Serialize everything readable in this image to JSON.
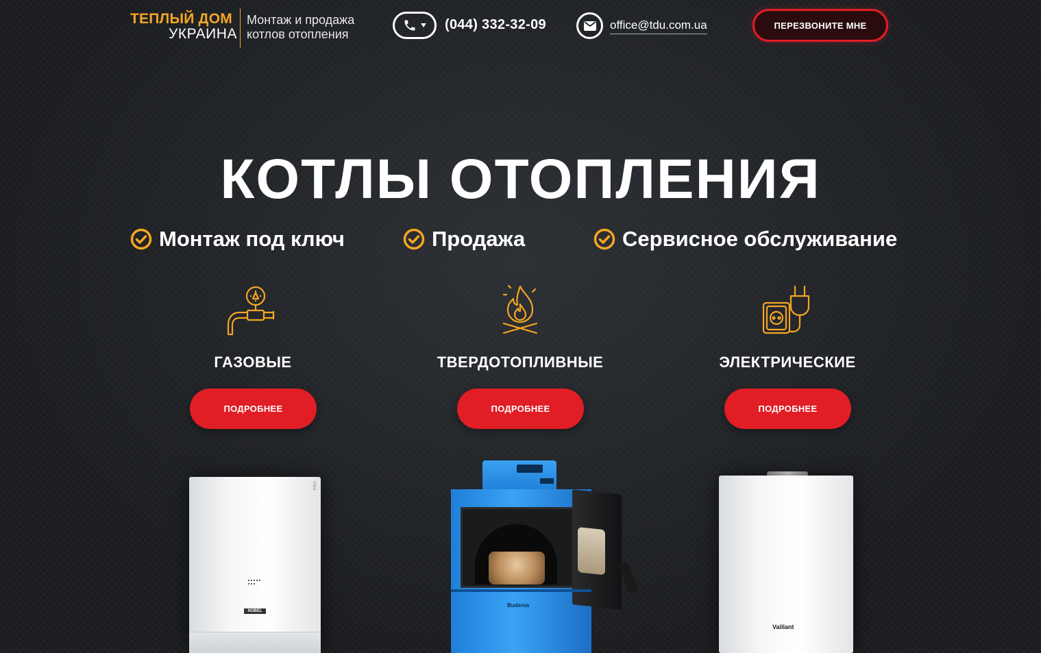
{
  "header": {
    "logo_line1": "ТЕПЛЫЙ ДОМ",
    "logo_line2": "УКРАИНА",
    "tagline_line1": "Монтаж и продажа",
    "tagline_line2": "котлов отопления",
    "phone": "(044) 332-32-09",
    "email": "office@tdu.com.ua",
    "callback_label": "ПЕРЕЗВОНИТЕ МНЕ"
  },
  "hero": {
    "title": "КОТЛЫ ОТОПЛЕНИЯ",
    "features": [
      "Монтаж под ключ",
      "Продажа",
      "Сервисное обслуживание"
    ]
  },
  "categories": [
    {
      "title": "ГАЗОВЫЕ",
      "button": "ПОДРОБНЕЕ",
      "icon": "gas-valve-icon"
    },
    {
      "title": "ТВЕРДОТОПЛИВНЫЕ",
      "button": "ПОДРОБНЕЕ",
      "icon": "fire-icon"
    },
    {
      "title": "ЭЛЕКТРИЧЕСКИЕ",
      "button": "ПОДРОБНЕЕ",
      "icon": "plug-socket-icon"
    }
  ],
  "products": {
    "brand_left": "NOBEL",
    "model_left": "PRO",
    "brand_center": "Buderus",
    "brand_right": "Vaillant"
  },
  "colors": {
    "accent": "#f5a623",
    "button_red": "#e11d25",
    "background": "#1d1f22"
  }
}
